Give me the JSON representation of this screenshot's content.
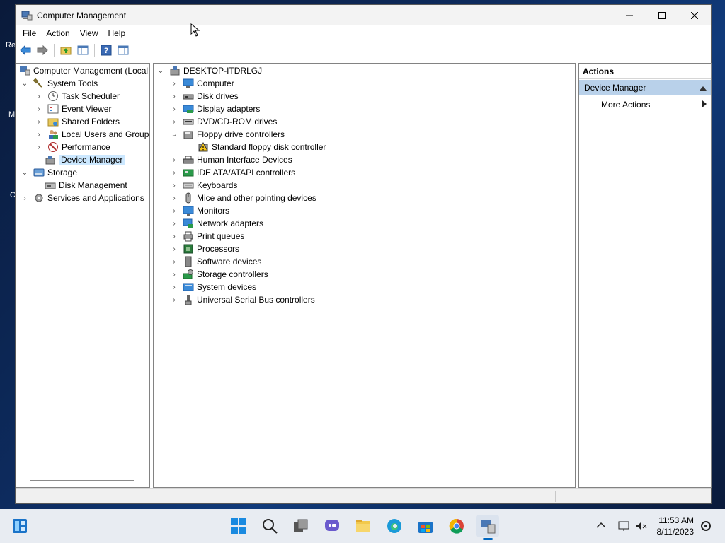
{
  "window": {
    "title": "Computer Management"
  },
  "menu": [
    "File",
    "Action",
    "View",
    "Help"
  ],
  "left_tree": {
    "root": "Computer Management (Local",
    "system_tools": "System Tools",
    "task_scheduler": "Task Scheduler",
    "event_viewer": "Event Viewer",
    "shared_folders": "Shared Folders",
    "local_users": "Local Users and Groups",
    "performance": "Performance",
    "device_manager": "Device Manager",
    "storage": "Storage",
    "disk_management": "Disk Management",
    "services": "Services and Applications"
  },
  "device_tree": {
    "root": "DESKTOP-ITDRLGJ",
    "categories": [
      "Computer",
      "Disk drives",
      "Display adapters",
      "DVD/CD-ROM drives",
      "Floppy drive controllers",
      "Human Interface Devices",
      "IDE ATA/ATAPI controllers",
      "Keyboards",
      "Mice and other pointing devices",
      "Monitors",
      "Network adapters",
      "Print queues",
      "Processors",
      "Software devices",
      "Storage controllers",
      "System devices",
      "Universal Serial Bus controllers"
    ],
    "floppy_child": "Standard floppy disk controller"
  },
  "actions": {
    "header": "Actions",
    "section": "Device Manager",
    "more": "More Actions"
  },
  "desktop": {
    "label_re": "Re",
    "label_m": "M",
    "label_c": "C"
  },
  "taskbar": {
    "time": "11:53 AM",
    "date": "8/11/2023",
    "colors": {
      "accent": "#0067c0",
      "selection": "#cce8ff",
      "actions_section": "#b9d1ea"
    }
  }
}
